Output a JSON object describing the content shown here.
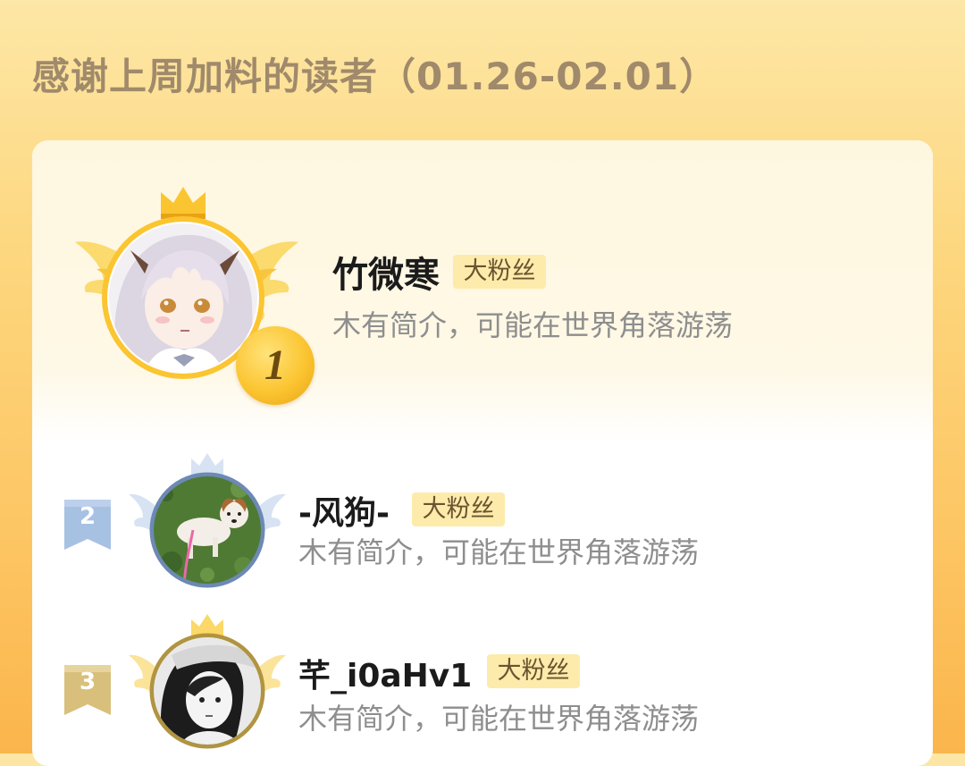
{
  "page": {
    "title": "感谢上周加料的读者（01.26-02.01）"
  },
  "readers": [
    {
      "rank": "1",
      "name": "竹微寒",
      "badge": "大粉丝",
      "intro": "木有简介，可能在世界角落游荡",
      "avatar": "anime-girl-avatar"
    },
    {
      "rank": "2",
      "name": "-风狗-",
      "badge": "大粉丝",
      "intro": "木有简介，可能在世界角落游荡",
      "avatar": "dog-on-grass-avatar"
    },
    {
      "rank": "3",
      "name": "芊_i0aHv1",
      "badge": "大粉丝",
      "intro": "木有简介，可能在世界角落游荡",
      "avatar": "monochrome-portrait-avatar"
    }
  ],
  "colors": {
    "gold": "#fbc531",
    "silver": "#9db8dc",
    "bronze": "#d9c383",
    "badge_bg": "#fcebaa",
    "title_text": "#a08a6b"
  }
}
